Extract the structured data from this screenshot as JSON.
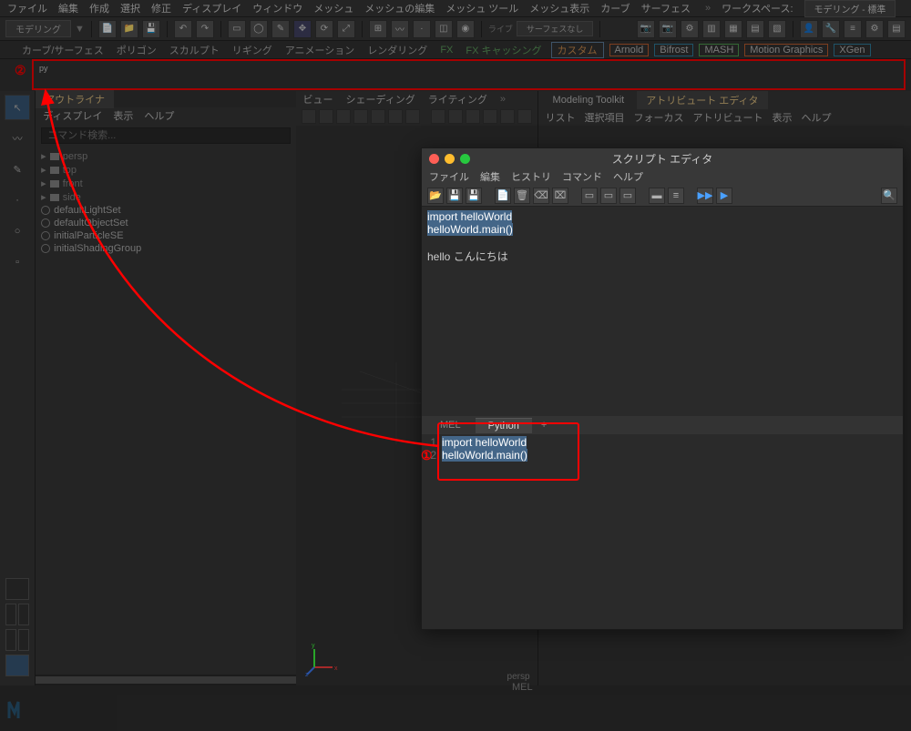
{
  "menu": [
    "ファイル",
    "編集",
    "作成",
    "選択",
    "修正",
    "ディスプレイ",
    "ウィンドウ",
    "メッシュ",
    "メッシュの編集",
    "メッシュ ツール",
    "メッシュ表示",
    "カーブ",
    "サーフェス"
  ],
  "workspace_label": "ワークスペース:",
  "workspace_value": "モデリング - 標準",
  "mode_dropdown": "モデリング",
  "live_label": "ライブ",
  "surface_none": "サーフェスなし",
  "shelf": {
    "tabs": [
      "カーブ/サーフェス",
      "ポリゴン",
      "スカルプト",
      "リギング",
      "アニメーション",
      "レンダリング",
      "FX",
      "FX キャッシング",
      "カスタム",
      "Arnold",
      "Bifrost",
      "MASH",
      "Motion Graphics",
      "XGen"
    ],
    "active": "カスタム"
  },
  "outliner": {
    "title": "アウトライナ",
    "menu": [
      "ディスプレイ",
      "表示",
      "ヘルプ"
    ],
    "search_placeholder": "コマンド検索...",
    "cameras": [
      "persp",
      "top",
      "front",
      "side"
    ],
    "items": [
      "defaultLightSet",
      "defaultObjectSet",
      "initialParticleSE",
      "initialShadingGroup"
    ]
  },
  "viewport": {
    "menu": [
      "ビュー",
      "シェーディング",
      "ライティング"
    ],
    "label": "persp"
  },
  "right_panel": {
    "tabs": [
      "Modeling Toolkit",
      "アトリビュート エディタ"
    ],
    "active": "アトリビュート エディタ",
    "menu": [
      "リスト",
      "選択項目",
      "フォーカス",
      "アトリビュート",
      "表示",
      "ヘルプ"
    ]
  },
  "script_editor": {
    "title": "スクリプト エディタ",
    "menu": [
      "ファイル",
      "編集",
      "ヒストリ",
      "コマンド",
      "ヘルプ"
    ],
    "output_lines": [
      "import helloWorld",
      "helloWorld.main()",
      "",
      "hello こんにちは"
    ],
    "tabs": [
      "MEL",
      "Python"
    ],
    "plus": "+",
    "code_lines": [
      "import helloWorld",
      "helloWorld.main()"
    ]
  },
  "bottom": {
    "mel": "MEL"
  },
  "annotations": {
    "label1": "①",
    "label2": "②"
  }
}
